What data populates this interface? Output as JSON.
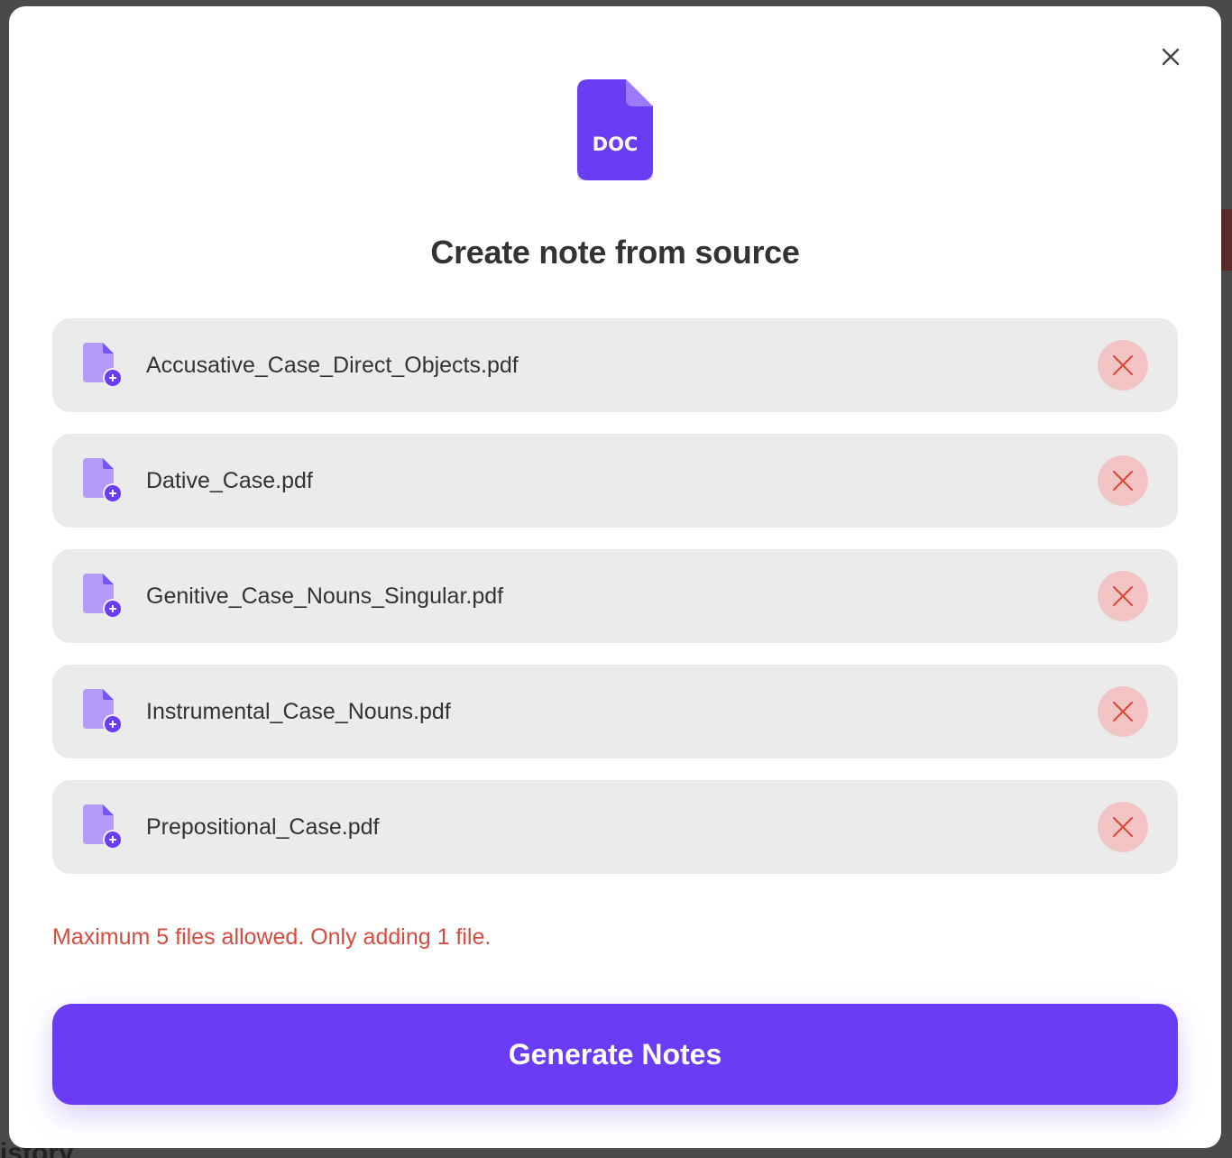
{
  "modal": {
    "title": "Create note from source",
    "doc_icon_text": "DOC",
    "close_icon": "close-icon",
    "files": [
      {
        "name": "Accusative_Case_Direct_Objects.pdf"
      },
      {
        "name": "Dative_Case.pdf"
      },
      {
        "name": "Genitive_Case_Nouns_Singular.pdf"
      },
      {
        "name": "Instrumental_Case_Nouns.pdf"
      },
      {
        "name": "Prepositional_Case.pdf"
      }
    ],
    "error_message": "Maximum 5 files allowed. Only adding 1 file.",
    "generate_label": "Generate Notes"
  },
  "background": {
    "partial_text": "istory"
  },
  "colors": {
    "accent": "#6a3cf5",
    "file_icon": "#b49bf9",
    "error": "#d64b40",
    "remove_bg": "#f2c4c4",
    "row_bg": "#ebebeb"
  }
}
